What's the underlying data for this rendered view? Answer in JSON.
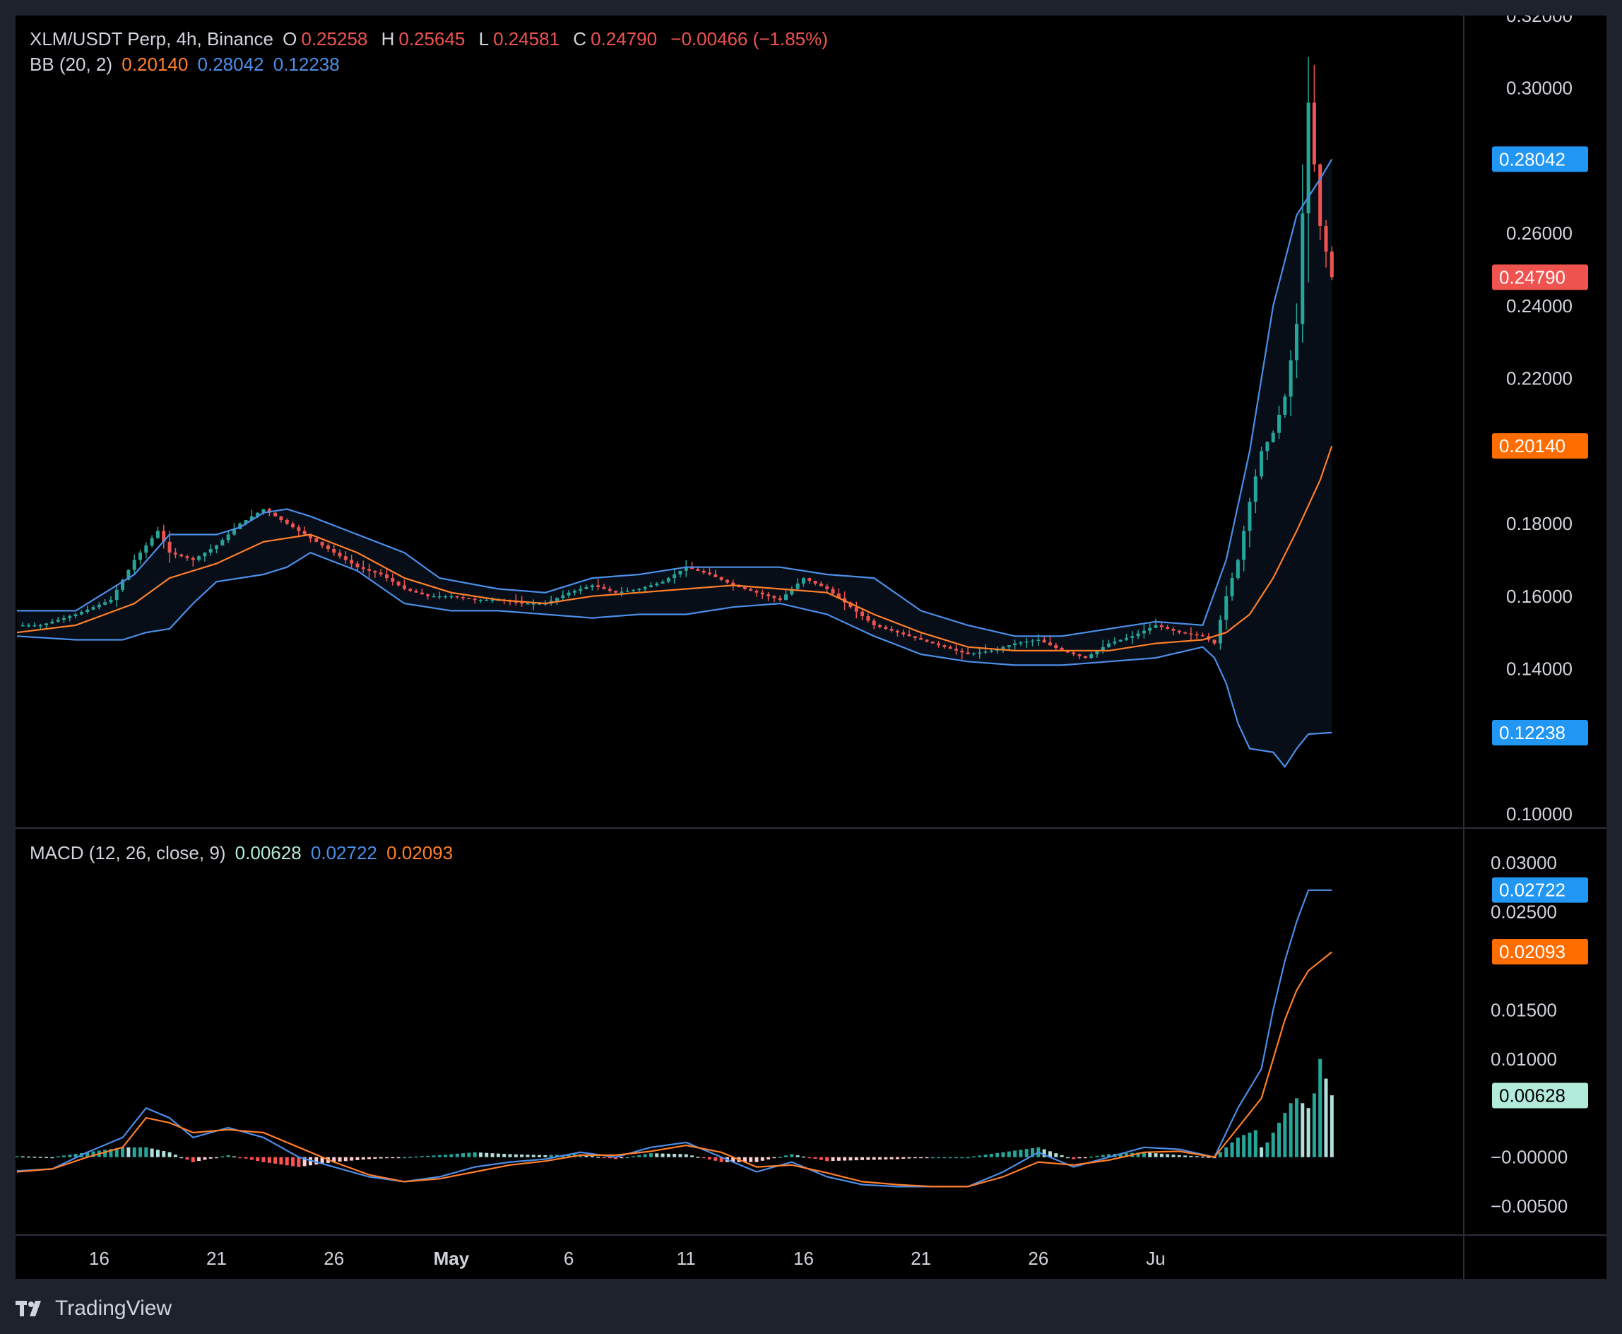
{
  "header": {
    "symbol": "XLM/USDT Perp, 4h, Binance",
    "open_label": "O",
    "open": "0.25258",
    "high_label": "H",
    "high": "0.25645",
    "low_label": "L",
    "low": "0.24581",
    "close_label": "C",
    "close": "0.24790",
    "change": "−0.00466 (−1.85%)"
  },
  "bb": {
    "label": "BB (20, 2)",
    "basis": "0.20140",
    "upper": "0.28042",
    "lower": "0.12238"
  },
  "macd": {
    "label": "MACD (12, 26, close, 9)",
    "hist": "0.00628",
    "macd": "0.02722",
    "signal": "0.02093"
  },
  "colors": {
    "up": "#26a69a",
    "down": "#ef5350",
    "basis": "#ff7f2a",
    "band": "#4c8ee8",
    "hist_up_strong": "#26a69a",
    "hist_up_weak": "#b2dfdb",
    "hist_down_strong": "#ff5252",
    "hist_down_weak": "#ffcdd2",
    "price_badge": "#ef5350",
    "upper_badge": "#2196f3",
    "basis_badge": "#ff6d00",
    "hist_badge": "#b2ebda"
  },
  "branding": {
    "name": "TradingView"
  },
  "chart_data": [
    {
      "type": "candlestick",
      "title": "XLM/USDT Perp, 4h, Binance",
      "x_ticks": [
        "16",
        "21",
        "26",
        "May",
        "6",
        "11",
        "16",
        "21",
        "26",
        "Ju"
      ],
      "y_ticks": [
        "0.32000",
        "0.30000",
        "0.26000",
        "0.24000",
        "0.22000",
        "0.18000",
        "0.16000",
        "0.14000",
        "0.10000"
      ],
      "ylim": [
        0.1,
        0.32
      ],
      "last_price": "0.24790",
      "bollinger": {
        "basis_last": "0.20140",
        "upper_last": "0.28042",
        "lower_last": "0.12238",
        "close_path": [
          [
            0,
            0.152
          ],
          [
            2,
            0.152
          ],
          [
            5,
            0.155
          ],
          [
            8,
            0.159
          ],
          [
            10,
            0.17
          ],
          [
            12,
            0.178
          ],
          [
            13,
            0.172
          ],
          [
            15,
            0.17
          ],
          [
            17,
            0.174
          ],
          [
            19,
            0.18
          ],
          [
            21,
            0.184
          ],
          [
            23,
            0.18
          ],
          [
            25,
            0.176
          ],
          [
            27,
            0.172
          ],
          [
            29,
            0.168
          ],
          [
            31,
            0.166
          ],
          [
            33,
            0.162
          ],
          [
            35,
            0.16
          ],
          [
            37,
            0.16
          ],
          [
            39,
            0.159
          ],
          [
            41,
            0.159
          ],
          [
            43,
            0.158
          ],
          [
            45,
            0.158
          ],
          [
            47,
            0.161
          ],
          [
            49,
            0.163
          ],
          [
            51,
            0.161
          ],
          [
            53,
            0.162
          ],
          [
            55,
            0.164
          ],
          [
            57,
            0.168
          ],
          [
            59,
            0.166
          ],
          [
            61,
            0.163
          ],
          [
            63,
            0.161
          ],
          [
            65,
            0.159
          ],
          [
            67,
            0.165
          ],
          [
            69,
            0.162
          ],
          [
            71,
            0.157
          ],
          [
            73,
            0.152
          ],
          [
            75,
            0.15
          ],
          [
            77,
            0.148
          ],
          [
            79,
            0.146
          ],
          [
            81,
            0.144
          ],
          [
            83,
            0.145
          ],
          [
            85,
            0.147
          ],
          [
            87,
            0.148
          ],
          [
            89,
            0.145
          ],
          [
            91,
            0.143
          ],
          [
            93,
            0.147
          ],
          [
            95,
            0.149
          ],
          [
            97,
            0.152
          ],
          [
            99,
            0.15
          ],
          [
            101,
            0.149
          ],
          [
            102,
            0.147
          ],
          [
            103,
            0.16
          ],
          [
            104,
            0.17
          ],
          [
            105,
            0.186
          ],
          [
            106,
            0.2
          ],
          [
            107,
            0.205
          ],
          [
            108,
            0.215
          ],
          [
            109,
            0.235
          ],
          [
            110,
            0.296
          ],
          [
            111,
            0.262
          ],
          [
            112,
            0.2479
          ]
        ],
        "basis_path": [
          [
            0,
            0.15
          ],
          [
            5,
            0.152
          ],
          [
            10,
            0.158
          ],
          [
            13,
            0.165
          ],
          [
            17,
            0.169
          ],
          [
            21,
            0.175
          ],
          [
            25,
            0.177
          ],
          [
            29,
            0.172
          ],
          [
            33,
            0.165
          ],
          [
            37,
            0.161
          ],
          [
            41,
            0.159
          ],
          [
            45,
            0.158
          ],
          [
            49,
            0.16
          ],
          [
            53,
            0.161
          ],
          [
            57,
            0.162
          ],
          [
            61,
            0.163
          ],
          [
            65,
            0.162
          ],
          [
            69,
            0.161
          ],
          [
            73,
            0.155
          ],
          [
            77,
            0.15
          ],
          [
            81,
            0.146
          ],
          [
            85,
            0.145
          ],
          [
            89,
            0.145
          ],
          [
            93,
            0.145
          ],
          [
            97,
            0.147
          ],
          [
            101,
            0.148
          ],
          [
            103,
            0.15
          ],
          [
            105,
            0.155
          ],
          [
            107,
            0.165
          ],
          [
            109,
            0.178
          ],
          [
            111,
            0.192
          ],
          [
            112,
            0.2014
          ]
        ],
        "upper_path": [
          [
            0,
            0.156
          ],
          [
            5,
            0.156
          ],
          [
            10,
            0.166
          ],
          [
            13,
            0.177
          ],
          [
            17,
            0.177
          ],
          [
            19,
            0.179
          ],
          [
            21,
            0.183
          ],
          [
            23,
            0.184
          ],
          [
            25,
            0.182
          ],
          [
            29,
            0.177
          ],
          [
            33,
            0.172
          ],
          [
            36,
            0.165
          ],
          [
            41,
            0.162
          ],
          [
            45,
            0.161
          ],
          [
            49,
            0.165
          ],
          [
            53,
            0.166
          ],
          [
            57,
            0.168
          ],
          [
            61,
            0.168
          ],
          [
            65,
            0.168
          ],
          [
            69,
            0.166
          ],
          [
            73,
            0.165
          ],
          [
            77,
            0.156
          ],
          [
            81,
            0.152
          ],
          [
            85,
            0.149
          ],
          [
            89,
            0.149
          ],
          [
            93,
            0.151
          ],
          [
            97,
            0.153
          ],
          [
            101,
            0.152
          ],
          [
            103,
            0.17
          ],
          [
            105,
            0.2
          ],
          [
            107,
            0.24
          ],
          [
            109,
            0.265
          ],
          [
            111,
            0.275
          ],
          [
            112,
            0.2804
          ]
        ],
        "lower_path": [
          [
            0,
            0.149
          ],
          [
            5,
            0.148
          ],
          [
            9,
            0.148
          ],
          [
            11,
            0.15
          ],
          [
            13,
            0.151
          ],
          [
            15,
            0.158
          ],
          [
            17,
            0.164
          ],
          [
            21,
            0.166
          ],
          [
            23,
            0.168
          ],
          [
            25,
            0.172
          ],
          [
            29,
            0.167
          ],
          [
            33,
            0.158
          ],
          [
            37,
            0.156
          ],
          [
            41,
            0.156
          ],
          [
            45,
            0.155
          ],
          [
            49,
            0.154
          ],
          [
            53,
            0.155
          ],
          [
            57,
            0.155
          ],
          [
            61,
            0.157
          ],
          [
            65,
            0.158
          ],
          [
            69,
            0.155
          ],
          [
            73,
            0.149
          ],
          [
            77,
            0.144
          ],
          [
            81,
            0.142
          ],
          [
            85,
            0.141
          ],
          [
            89,
            0.141
          ],
          [
            93,
            0.142
          ],
          [
            97,
            0.143
          ],
          [
            101,
            0.146
          ],
          [
            102,
            0.143
          ],
          [
            103,
            0.136
          ],
          [
            104,
            0.125
          ],
          [
            105,
            0.118
          ],
          [
            107,
            0.117
          ],
          [
            108,
            0.113
          ],
          [
            109,
            0.118
          ],
          [
            110,
            0.122
          ],
          [
            112,
            0.1224
          ]
        ]
      }
    },
    {
      "type": "macd",
      "title": "MACD (12, 26, close, 9)",
      "y_ticks": [
        "0.03000",
        "0.02500",
        "0.01500",
        "0.01000",
        "−0.00000",
        "−0.00500"
      ],
      "ylim": [
        -0.0065,
        0.0305
      ],
      "last": {
        "histogram": "0.00628",
        "macd": "0.02722",
        "signal": "0.02093"
      },
      "macd_path": [
        [
          0,
          -0.0014
        ],
        [
          3,
          -0.0012
        ],
        [
          6,
          0.0005
        ],
        [
          9,
          0.002
        ],
        [
          11,
          0.005
        ],
        [
          13,
          0.004
        ],
        [
          15,
          0.002
        ],
        [
          18,
          0.003
        ],
        [
          21,
          0.002
        ],
        [
          24,
          0.0
        ],
        [
          27,
          -0.001
        ],
        [
          30,
          -0.002
        ],
        [
          33,
          -0.0025
        ],
        [
          36,
          -0.002
        ],
        [
          39,
          -0.001
        ],
        [
          42,
          -0.0005
        ],
        [
          45,
          -0.0002
        ],
        [
          48,
          0.0005
        ],
        [
          51,
          0.0
        ],
        [
          54,
          0.001
        ],
        [
          57,
          0.0015
        ],
        [
          60,
          0.0
        ],
        [
          63,
          -0.0015
        ],
        [
          66,
          -0.0005
        ],
        [
          69,
          -0.002
        ],
        [
          72,
          -0.0028
        ],
        [
          75,
          -0.003
        ],
        [
          78,
          -0.003
        ],
        [
          81,
          -0.003
        ],
        [
          84,
          -0.0015
        ],
        [
          87,
          0.0005
        ],
        [
          90,
          -0.001
        ],
        [
          93,
          0.0
        ],
        [
          96,
          0.001
        ],
        [
          99,
          0.0008
        ],
        [
          102,
          0.0
        ],
        [
          104,
          0.005
        ],
        [
          106,
          0.009
        ],
        [
          107,
          0.015
        ],
        [
          108,
          0.02
        ],
        [
          109,
          0.024
        ],
        [
          110,
          0.0272
        ],
        [
          112,
          0.0272
        ]
      ],
      "signal_path": [
        [
          0,
          -0.0015
        ],
        [
          3,
          -0.0012
        ],
        [
          6,
          0.0
        ],
        [
          9,
          0.001
        ],
        [
          11,
          0.004
        ],
        [
          13,
          0.0035
        ],
        [
          15,
          0.0025
        ],
        [
          18,
          0.0028
        ],
        [
          21,
          0.0025
        ],
        [
          24,
          0.001
        ],
        [
          27,
          -0.0005
        ],
        [
          30,
          -0.0018
        ],
        [
          33,
          -0.0025
        ],
        [
          36,
          -0.0022
        ],
        [
          39,
          -0.0015
        ],
        [
          42,
          -0.0008
        ],
        [
          45,
          -0.0004
        ],
        [
          48,
          0.0002
        ],
        [
          51,
          0.0002
        ],
        [
          54,
          0.0006
        ],
        [
          57,
          0.0012
        ],
        [
          60,
          0.0005
        ],
        [
          63,
          -0.001
        ],
        [
          66,
          -0.0008
        ],
        [
          69,
          -0.0016
        ],
        [
          72,
          -0.0025
        ],
        [
          75,
          -0.0028
        ],
        [
          78,
          -0.003
        ],
        [
          81,
          -0.003
        ],
        [
          84,
          -0.002
        ],
        [
          87,
          -0.0005
        ],
        [
          90,
          -0.0008
        ],
        [
          93,
          -0.0003
        ],
        [
          96,
          0.0005
        ],
        [
          99,
          0.0006
        ],
        [
          102,
          0.0
        ],
        [
          104,
          0.003
        ],
        [
          106,
          0.006
        ],
        [
          107,
          0.01
        ],
        [
          108,
          0.014
        ],
        [
          109,
          0.017
        ],
        [
          110,
          0.019
        ],
        [
          112,
          0.0209
        ]
      ],
      "hist_last_values": [
        0.001,
        0.0015,
        0.0025,
        0.0035,
        0.0045,
        0.0055,
        0.006,
        0.0055,
        0.005,
        0.0065,
        0.01,
        0.008,
        0.0063
      ]
    }
  ]
}
